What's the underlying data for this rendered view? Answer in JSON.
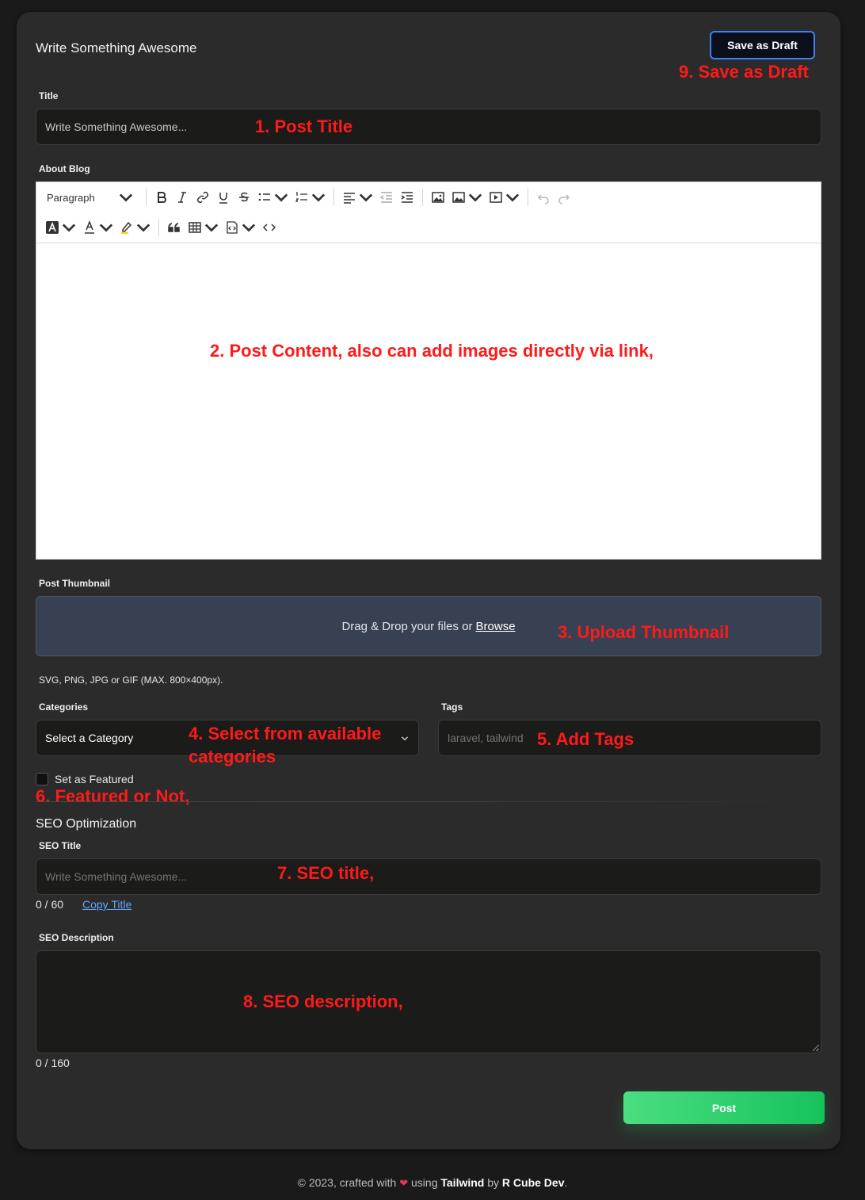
{
  "header": {
    "title": "Write Something Awesome",
    "draft_label": "Save as Draft"
  },
  "title_field": {
    "label": "Title",
    "placeholder": "Write Something Awesome..."
  },
  "editor": {
    "label": "About Blog",
    "paragraph_select": "Paragraph"
  },
  "thumbnail": {
    "label": "Post Thumbnail",
    "drop_text": "Drag & Drop your files or",
    "browse": "Browse",
    "hint": "SVG, PNG, JPG or GIF (MAX. 800×400px)."
  },
  "categories": {
    "label": "Categories",
    "selected": "Select a Category"
  },
  "tags": {
    "label": "Tags",
    "placeholder": "laravel, tailwind"
  },
  "featured": {
    "label": "Set as Featured",
    "checked": false
  },
  "seo": {
    "heading": "SEO Optimization",
    "title_label": "SEO Title",
    "title_placeholder": "Write Something Awesome...",
    "title_counter": "0 / 60",
    "copy_title": "Copy Title",
    "desc_label": "SEO Description",
    "desc_counter": "0 / 160"
  },
  "post_button": "Post",
  "footer": {
    "prefix": "© 2023, crafted with",
    "using": "using",
    "framework": "Tailwind",
    "by": "by",
    "author": "R Cube Dev",
    "suffix": "."
  },
  "annotations": {
    "a1": "1. Post Title",
    "a2": "2. Post Content, also can add images directly via link,",
    "a3": "3. Upload Thumbnail",
    "a4_line1": "4. Select from available",
    "a4_line2": "categories",
    "a5": "5. Add Tags",
    "a6": "6. Featured or Not,",
    "a7": "7. SEO title,",
    "a8": "8. SEO description,",
    "a9": "9. Save as Draft"
  },
  "colors": {
    "page_bg": "#1a1a1a",
    "card_bg": "#2b2b2b",
    "input_bg": "#1b1b19",
    "dropzone_bg": "#374151",
    "accent_blue": "#3b82f6",
    "link_blue": "#60a5fa",
    "post_green": "#22c55e",
    "annotation_red": "#ff1a1a"
  }
}
